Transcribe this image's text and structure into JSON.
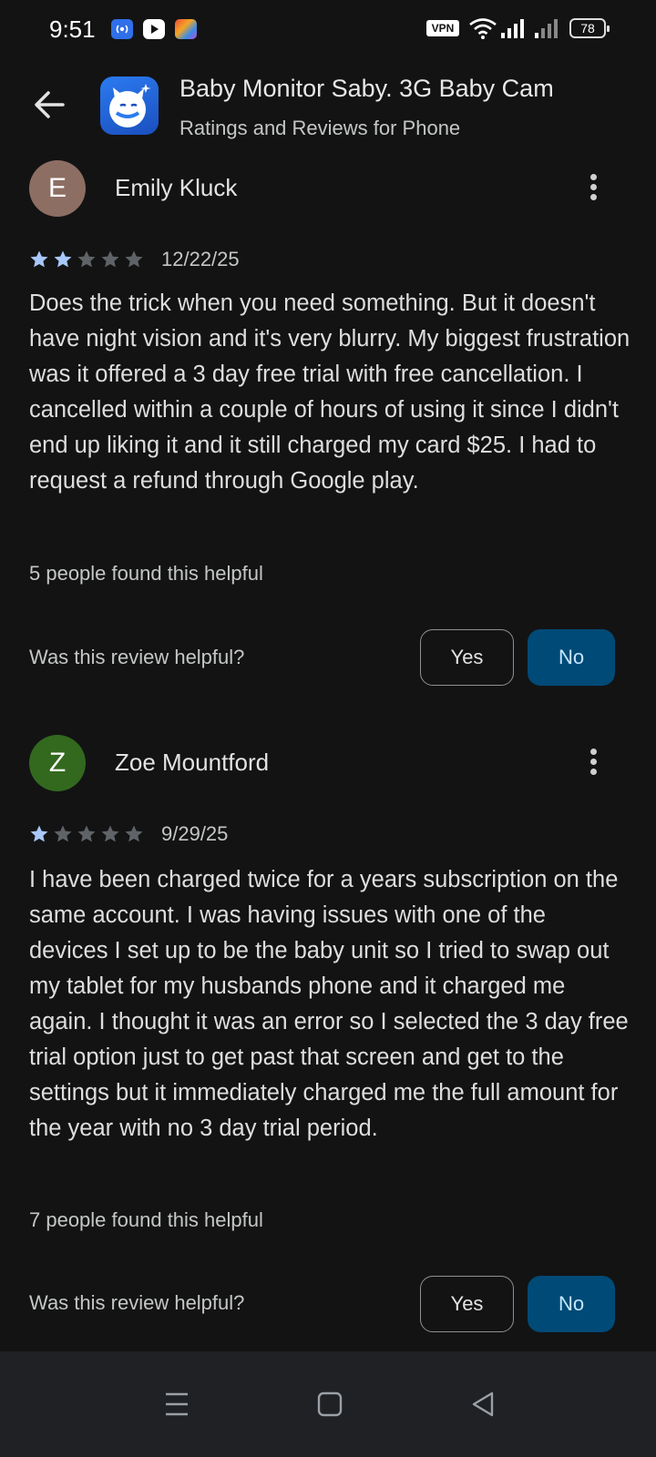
{
  "status_bar": {
    "time": "9:51",
    "vpn_label": "VPN",
    "battery": "78"
  },
  "header": {
    "app_title": "Baby Monitor Saby. 3G Baby Cam",
    "subtitle": "Ratings and Reviews for Phone"
  },
  "reviews": [
    {
      "initial": "E",
      "avatar_color": "#8d6e63",
      "name": "Emily Kluck",
      "rating": 2,
      "date": "12/22/25",
      "text": "Does the trick when you need something. But it doesn't have night vision and it's very blurry. My biggest frustration was it offered a 3 day free trial with free cancellation. I cancelled within a couple of hours of using it since I didn't end up liking it and it still charged my card $25. I had to request a refund through Google play.",
      "helpful_count": "5 people found this helpful",
      "helpful_question": "Was this review helpful?",
      "yes_label": "Yes",
      "no_label": "No"
    },
    {
      "initial": "Z",
      "avatar_color": "#33691e",
      "name": "Zoe Mountford",
      "rating": 1,
      "date": "9/29/25",
      "text": "I have been charged twice for a years subscription on the same account. I was having issues with one of the devices I set up to be the baby unit so I tried to swap out my tablet for my husbands phone and it charged me again. I thought it was an error so I selected the 3 day free trial option just to get past that screen and get to the settings but it immediately charged me the full amount for the year with no 3 day trial period.",
      "helpful_count": "7 people found this helpful",
      "helpful_question": "Was this review helpful?",
      "yes_label": "Yes",
      "no_label": "No"
    }
  ],
  "colors": {
    "background": "#131314",
    "star_filled": "#a8c7fa",
    "star_empty": "#5f6368",
    "no_button_bg": "#004a77",
    "no_button_text": "#c2e7ff"
  },
  "icons": {
    "back": "arrow-left-icon",
    "more": "more-vertical-icon",
    "nav_recents": "menu-icon",
    "nav_home": "square-home-icon",
    "nav_back": "triangle-back-icon"
  }
}
